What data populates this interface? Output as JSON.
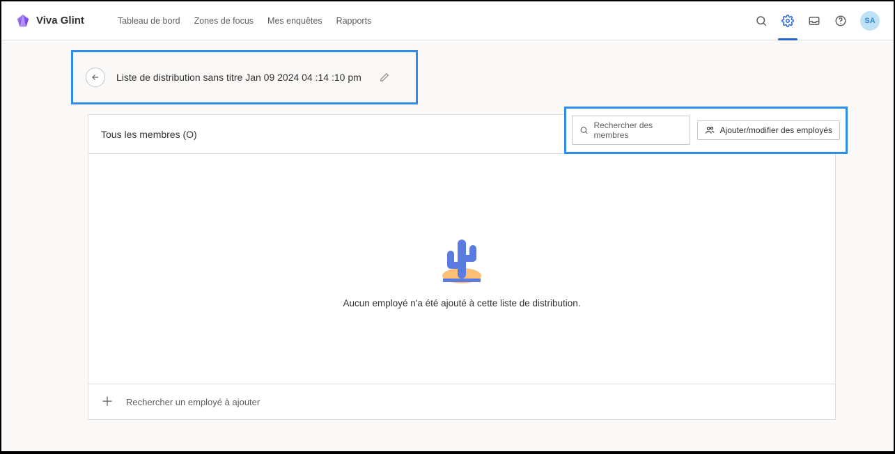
{
  "app": {
    "name": "Viva Glint"
  },
  "nav": {
    "items": [
      "Tableau de bord",
      "Zones de focus",
      "Mes enquêtes",
      "Rapports"
    ],
    "avatar_initials": "SA"
  },
  "page": {
    "title": "Liste de distribution sans titre Jan 09 2024 04 :14 :10 pm"
  },
  "members": {
    "title_prefix": "Tous les membres",
    "count_label": "(O)",
    "search_placeholder": "Rechercher des membres",
    "add_button_label": "Ajouter/modifier des employés",
    "empty_message": "Aucun employé n'a été ajouté à cette liste de distribution.",
    "footer_search_label": "Rechercher un employé à ajouter"
  }
}
